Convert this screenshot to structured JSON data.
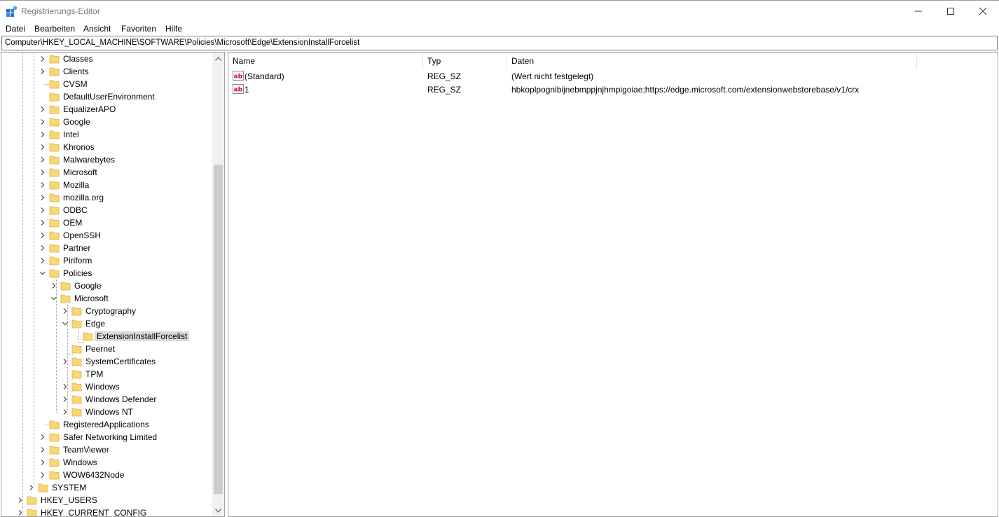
{
  "window": {
    "title": "Registrierungs-Editor"
  },
  "menu": {
    "items": [
      "Datei",
      "Bearbeiten",
      "Ansicht",
      "Favoriten",
      "Hilfe"
    ]
  },
  "address": {
    "path": "Computer\\HKEY_LOCAL_MACHINE\\SOFTWARE\\Policies\\Microsoft\\Edge\\ExtensionInstallForcelist"
  },
  "tree": {
    "items": [
      {
        "label": "Classes",
        "expanded": false
      },
      {
        "label": "Clients",
        "expanded": false
      },
      {
        "label": "CVSM",
        "expanded": false
      },
      {
        "label": "DefaultUserEnvironment",
        "expanded": false
      },
      {
        "label": "EqualizerAPO",
        "expanded": false
      },
      {
        "label": "Google",
        "expanded": false
      },
      {
        "label": "Intel",
        "expanded": false
      },
      {
        "label": "Khronos",
        "expanded": false
      },
      {
        "label": "Malwarebytes",
        "expanded": false
      },
      {
        "label": "Microsoft",
        "expanded": false
      },
      {
        "label": "Mozilla",
        "expanded": false
      },
      {
        "label": "mozilla.org",
        "expanded": false
      },
      {
        "label": "ODBC",
        "expanded": false
      },
      {
        "label": "OEM",
        "expanded": false
      },
      {
        "label": "OpenSSH",
        "expanded": false
      },
      {
        "label": "Partner",
        "expanded": false
      },
      {
        "label": "Piriform",
        "expanded": false
      },
      {
        "label": "Policies",
        "expanded": true
      },
      {
        "label": "Google",
        "expanded": false
      },
      {
        "label": "Microsoft",
        "expanded": true
      },
      {
        "label": "Cryptography",
        "expanded": false
      },
      {
        "label": "Edge",
        "expanded": true
      },
      {
        "label": "ExtensionInstallForcelist",
        "expanded": false,
        "selected": true
      },
      {
        "label": "Peernet",
        "expanded": false
      },
      {
        "label": "SystemCertificates",
        "expanded": false
      },
      {
        "label": "TPM",
        "expanded": false
      },
      {
        "label": "Windows",
        "expanded": false
      },
      {
        "label": "Windows Defender",
        "expanded": false
      },
      {
        "label": "Windows NT",
        "expanded": false
      },
      {
        "label": "RegisteredApplications",
        "expanded": false
      },
      {
        "label": "Safer Networking Limited",
        "expanded": false
      },
      {
        "label": "TeamViewer",
        "expanded": false
      },
      {
        "label": "Windows",
        "expanded": false
      },
      {
        "label": "WOW6432Node",
        "expanded": false
      },
      {
        "label": "SYSTEM",
        "expanded": false
      },
      {
        "label": "HKEY_USERS",
        "expanded": false
      },
      {
        "label": "HKEY_CURRENT_CONFIG",
        "expanded": false
      }
    ]
  },
  "values": {
    "columns": [
      "Name",
      "Typ",
      "Daten"
    ],
    "rows": [
      {
        "name": "(Standard)",
        "type": "REG_SZ",
        "data": "(Wert nicht festgelegt)"
      },
      {
        "name": "1",
        "type": "REG_SZ",
        "data": "hbkoplpognibijnebmppjnjhmpigoiae;https://edge.microsoft.com/extensionwebstorebase/v1/crx"
      }
    ]
  },
  "icons": {
    "app": "registry-editor-icon",
    "folder": "folder-icon",
    "string_value": "string-value-icon"
  },
  "colors": {
    "folder": "#f8d775",
    "folder_dark": "#e0b040",
    "selection": "#d9d9d9",
    "string_icon_red": "#c8102e"
  }
}
